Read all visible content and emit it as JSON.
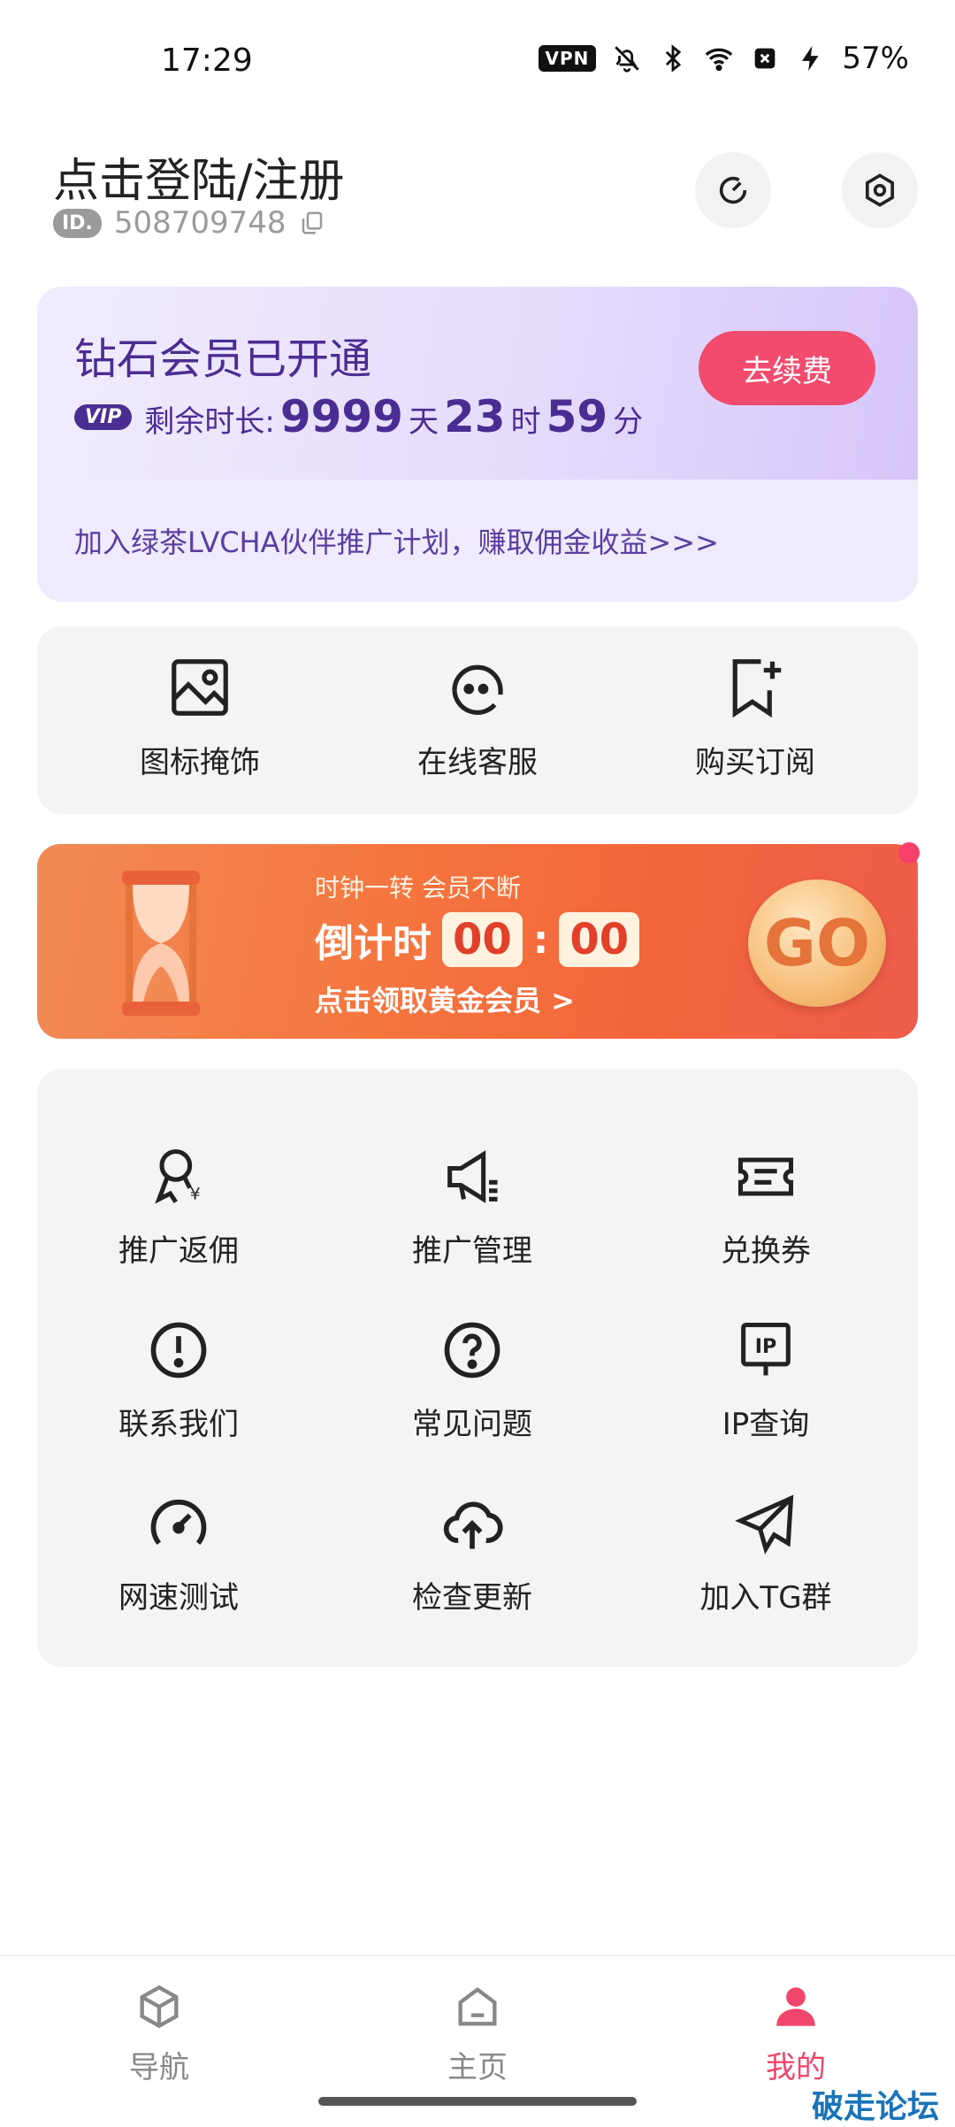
{
  "status_bar": {
    "time": "17:29",
    "vpn": "VPN",
    "battery": "57%",
    "icons": [
      "bell-off-icon",
      "bluetooth-icon",
      "wifi-icon",
      "no-sim-icon",
      "charging-icon"
    ]
  },
  "header": {
    "login_title": "点击登陆/注册",
    "id_label": "ID.",
    "id_value": "508709748",
    "icons": [
      "gauge-icon",
      "settings-icon",
      "copy-icon"
    ]
  },
  "vip_card": {
    "title": "钻石会员已开通",
    "vip_tag": "VIP",
    "remaining_label": "剩余时长:",
    "days": "9999",
    "days_unit": "天",
    "hours": "23",
    "hours_unit": "时",
    "minutes": "59",
    "minutes_unit": "分",
    "renew_button": "去续费",
    "promo_text": "加入绿茶LVCHA伙伴推广计划，赚取佣金收益>>>"
  },
  "quick_actions": [
    {
      "label": "图标掩饰",
      "icon": "image-icon"
    },
    {
      "label": "在线客服",
      "icon": "headset-icon"
    },
    {
      "label": "购买订阅",
      "icon": "bookmark-add-icon"
    }
  ],
  "banner": {
    "line1": "时钟一转 会员不断",
    "countdown_label": "倒计时",
    "countdown_min": "00",
    "countdown_sep": ":",
    "countdown_sec": "00",
    "line3": "点击领取黄金会员 >",
    "go_label": "GO",
    "accent": "#f5763f"
  },
  "menu_grid": [
    {
      "label": "推广返佣",
      "icon": "award-icon"
    },
    {
      "label": "推广管理",
      "icon": "megaphone-icon"
    },
    {
      "label": "兑换券",
      "icon": "ticket-icon"
    },
    {
      "label": "联系我们",
      "icon": "alert-circle-icon"
    },
    {
      "label": "常见问题",
      "icon": "help-circle-icon"
    },
    {
      "label": "IP查询",
      "icon": "ip-sign-icon",
      "icon_text": "IP"
    },
    {
      "label": "网速测试",
      "icon": "speedometer-icon"
    },
    {
      "label": "检查更新",
      "icon": "cloud-upload-icon"
    },
    {
      "label": "加入TG群",
      "icon": "telegram-icon"
    }
  ],
  "bottom_nav": [
    {
      "label": "导航",
      "icon": "cube-icon",
      "active": false
    },
    {
      "label": "主页",
      "icon": "home-icon",
      "active": false
    },
    {
      "label": "我的",
      "icon": "user-icon",
      "active": true
    }
  ],
  "watermark": "破走论坛",
  "colors": {
    "primary_pink": "#f0456c",
    "vip_purple": "#4a2d92",
    "card_bg": "#f4f4f4"
  }
}
